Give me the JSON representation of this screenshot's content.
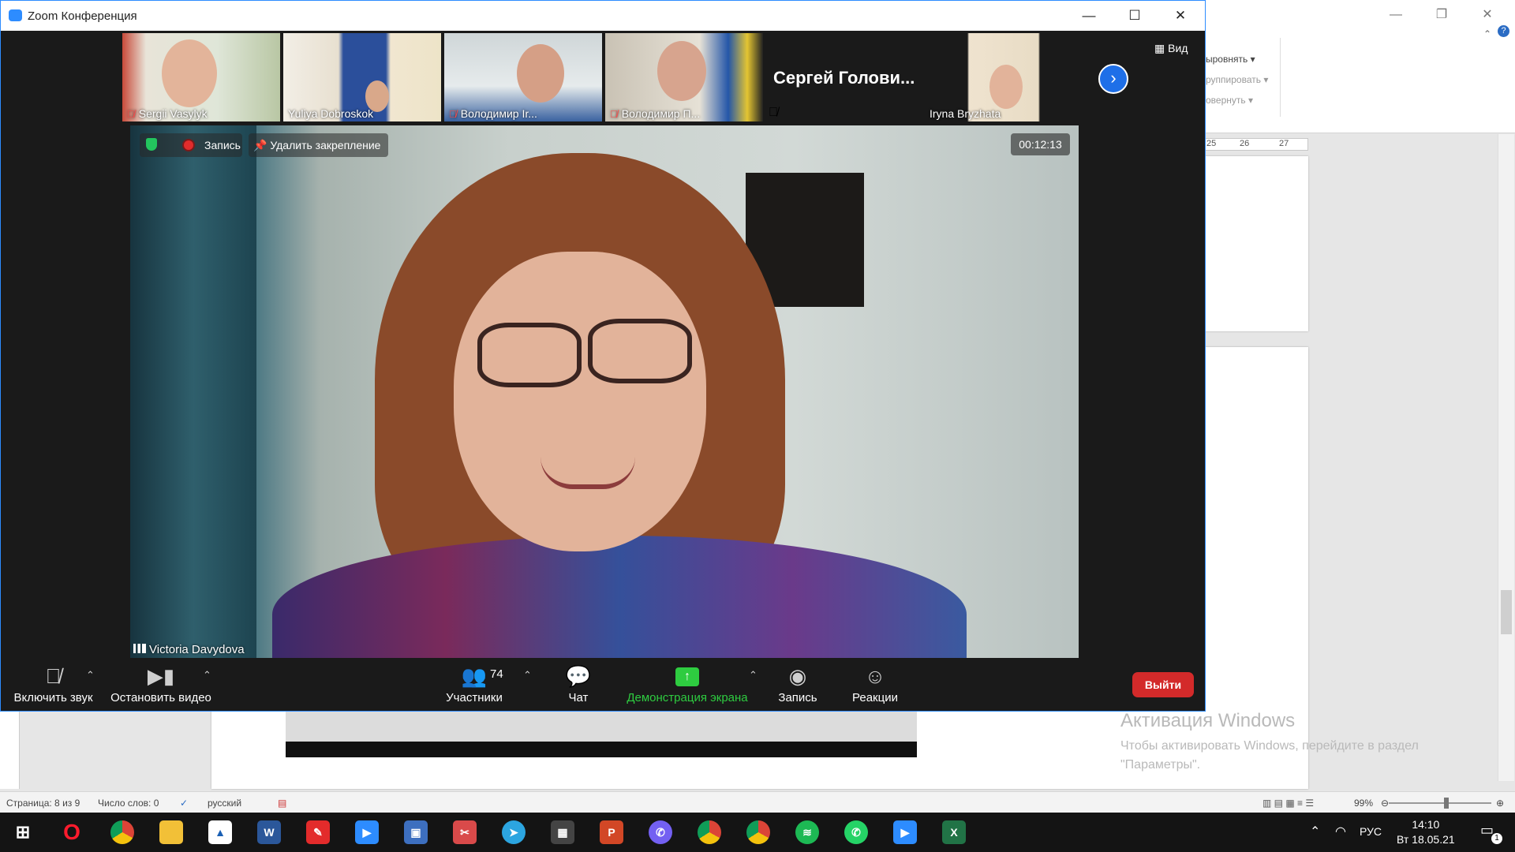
{
  "word": {
    "ribbon_items": [
      "ыровнять",
      "руппировать",
      "овернуть"
    ],
    "ruler_marks": [
      "25",
      "26",
      "27"
    ],
    "activation_title": "Активация Windows",
    "activation_text": "Чтобы активировать Windows, перейдите в раздел \"Параметры\".",
    "status": {
      "page": "Страница: 8 из 9",
      "words": "Число слов: 0",
      "language": "русский",
      "zoom": "99%"
    }
  },
  "zoom": {
    "title": "Zoom Конференция",
    "view_label": "Вид",
    "participants": [
      {
        "name": "Sergii Vasylyk",
        "muted": true
      },
      {
        "name": "Yuliya Dobroskok",
        "muted": false
      },
      {
        "name": "Володимир Ir...",
        "muted": true
      },
      {
        "name": "Володимир П...",
        "muted": true
      },
      {
        "name": "Сергей Голови...",
        "muted": true
      },
      {
        "name": "Iryna Bryzhata",
        "muted": false
      }
    ],
    "recording_label": "Запись",
    "unpin_label": "Удалить закрепление",
    "timer": "00:12:13",
    "active_speaker": "Victoria Davydova",
    "toolbar": {
      "unmute": "Включить звук",
      "stop_video": "Остановить видео",
      "participants": "Участники",
      "participants_count": "74",
      "chat": "Чат",
      "share": "Демонстрация экрана",
      "record": "Запись",
      "reactions": "Реакции",
      "leave": "Выйти"
    }
  },
  "taskbar": {
    "language": "РУС",
    "time": "14:10",
    "date": "Вт 18.05.21",
    "notification_count": "1"
  }
}
